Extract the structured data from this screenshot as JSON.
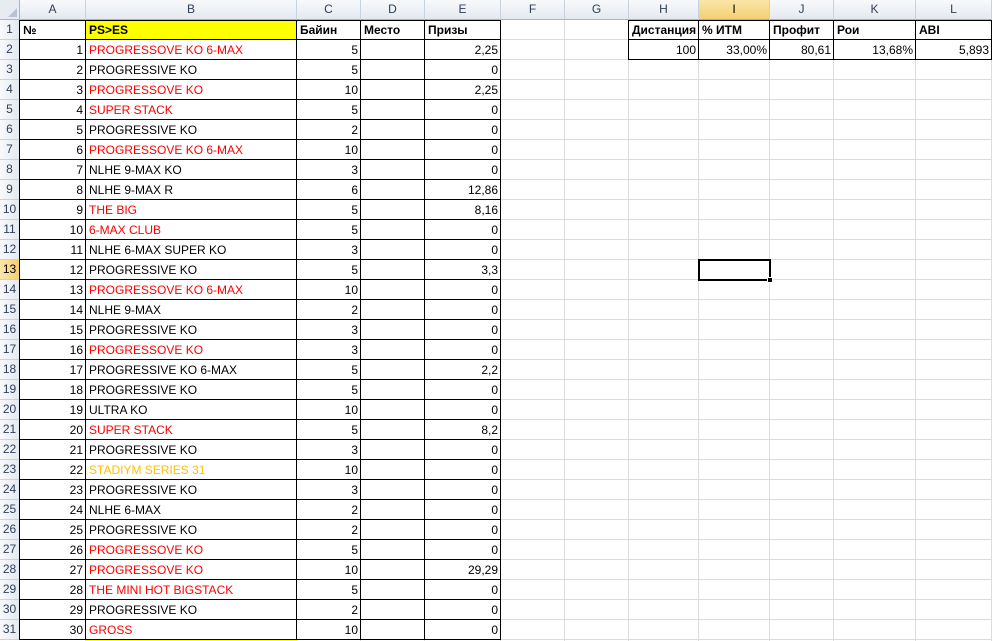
{
  "columns": [
    "A",
    "B",
    "C",
    "D",
    "E",
    "F",
    "G",
    "H",
    "I",
    "J",
    "K",
    "L"
  ],
  "selected_column": "I",
  "selected_row": "13",
  "row_numbers": [
    "1",
    "2",
    "3",
    "4",
    "5",
    "6",
    "7",
    "8",
    "9",
    "10",
    "11",
    "12",
    "13",
    "14",
    "15",
    "16",
    "17",
    "18",
    "19",
    "20",
    "21",
    "22",
    "23",
    "24",
    "25",
    "26",
    "27",
    "28",
    "29",
    "30",
    "31"
  ],
  "table_header": {
    "num": "№",
    "name": "PS>ES",
    "buyin": "Байин",
    "place": "Место",
    "prizes": "Призы"
  },
  "rows": [
    {
      "num": "1",
      "name": "PROGRESSOVE KO 6-MAX",
      "buyin": "5",
      "place": "",
      "prize": "2,25",
      "color": "red"
    },
    {
      "num": "2",
      "name": "PROGRESSIVE KO",
      "buyin": "5",
      "place": "",
      "prize": "0",
      "color": "black"
    },
    {
      "num": "3",
      "name": "PROGRESSOVE KO",
      "buyin": "10",
      "place": "",
      "prize": "2,25",
      "color": "red"
    },
    {
      "num": "4",
      "name": "SUPER STACK",
      "buyin": "5",
      "place": "",
      "prize": "0",
      "color": "red"
    },
    {
      "num": "5",
      "name": "PROGRESSIVE KO",
      "buyin": "2",
      "place": "",
      "prize": "0",
      "color": "black"
    },
    {
      "num": "6",
      "name": "PROGRESSOVE KO 6-MAX",
      "buyin": "10",
      "place": "",
      "prize": "0",
      "color": "red"
    },
    {
      "num": "7",
      "name": "NLHE 9-MAX KO",
      "buyin": "3",
      "place": "",
      "prize": "0",
      "color": "black"
    },
    {
      "num": "8",
      "name": "NLHE 9-MAX R",
      "buyin": "6",
      "place": "",
      "prize": "12,86",
      "color": "black"
    },
    {
      "num": "9",
      "name": "THE BIG",
      "buyin": "5",
      "place": "",
      "prize": "8,16",
      "color": "red"
    },
    {
      "num": "10",
      "name": "6-MAX CLUB",
      "buyin": "5",
      "place": "",
      "prize": "0",
      "color": "red"
    },
    {
      "num": "11",
      "name": "NLHE 6-MAX SUPER  KO",
      "buyin": "3",
      "place": "",
      "prize": "0",
      "color": "black"
    },
    {
      "num": "12",
      "name": "PROGRESSIVE KO",
      "buyin": "5",
      "place": "",
      "prize": "3,3",
      "color": "black"
    },
    {
      "num": "13",
      "name": "PROGRESSOVE KO 6-MAX",
      "buyin": "10",
      "place": "",
      "prize": "0",
      "color": "red"
    },
    {
      "num": "14",
      "name": "NLHE 9-MAX",
      "buyin": "2",
      "place": "",
      "prize": "0",
      "color": "black"
    },
    {
      "num": "15",
      "name": "PROGRESSIVE KO",
      "buyin": "3",
      "place": "",
      "prize": "0",
      "color": "black"
    },
    {
      "num": "16",
      "name": "PROGRESSOVE KO",
      "buyin": "3",
      "place": "",
      "prize": "0",
      "color": "red"
    },
    {
      "num": "17",
      "name": "PROGRESSIVE KO 6-MAX",
      "buyin": "5",
      "place": "",
      "prize": "2,2",
      "color": "black"
    },
    {
      "num": "18",
      "name": "PROGRESSIVE KO",
      "buyin": "5",
      "place": "",
      "prize": "0",
      "color": "black"
    },
    {
      "num": "19",
      "name": "ULTRA KO",
      "buyin": "10",
      "place": "",
      "prize": "0",
      "color": "black"
    },
    {
      "num": "20",
      "name": "SUPER STACK",
      "buyin": "5",
      "place": "",
      "prize": "8,2",
      "color": "red"
    },
    {
      "num": "21",
      "name": "PROGRESSIVE KO",
      "buyin": "3",
      "place": "",
      "prize": "0",
      "color": "black"
    },
    {
      "num": "22",
      "name": "STADIYM SERIES 31",
      "buyin": "10",
      "place": "",
      "prize": "0",
      "color": "orange"
    },
    {
      "num": "23",
      "name": "PROGRESSIVE KO",
      "buyin": "3",
      "place": "",
      "prize": "0",
      "color": "black"
    },
    {
      "num": "24",
      "name": "NLHE 6-MAX",
      "buyin": "2",
      "place": "",
      "prize": "0",
      "color": "black"
    },
    {
      "num": "25",
      "name": "PROGRESSIVE KO",
      "buyin": "2",
      "place": "",
      "prize": "0",
      "color": "black"
    },
    {
      "num": "26",
      "name": "PROGRESSOVE KO",
      "buyin": "5",
      "place": "",
      "prize": "0",
      "color": "red"
    },
    {
      "num": "27",
      "name": "PROGRESSOVE KO",
      "buyin": "10",
      "place": "",
      "prize": "29,29",
      "color": "red"
    },
    {
      "num": "28",
      "name": "THE MINI HOT BIGSTACK",
      "buyin": "5",
      "place": "",
      "prize": "0",
      "color": "red"
    },
    {
      "num": "29",
      "name": "PROGRESSIVE KO",
      "buyin": "2",
      "place": "",
      "prize": "0",
      "color": "black"
    },
    {
      "num": "30",
      "name": "GROSS",
      "buyin": "10",
      "place": "",
      "prize": "0",
      "color": "red"
    }
  ],
  "stats": {
    "headers": {
      "distance": "Дистанция",
      "itm": "% ИТМ",
      "profit": "Профит",
      "roi": "Рои",
      "abi": "ABI"
    },
    "values": {
      "distance": "100",
      "itm": "33,00%",
      "profit": "80,61",
      "roi": "13,68%",
      "abi": "5,893"
    }
  },
  "colors": {
    "red": "#ff0000",
    "orange": "#ffc000",
    "yellow_fill": "#ffff00",
    "selection": "#f4cf72"
  }
}
